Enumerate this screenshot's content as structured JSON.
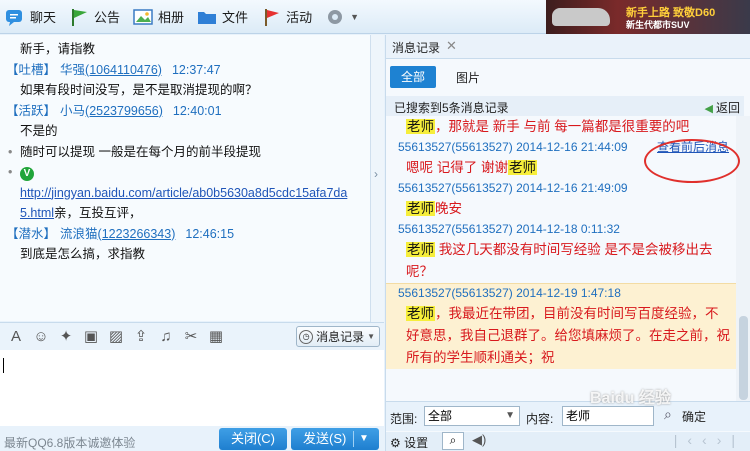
{
  "toolbar": {
    "items": [
      {
        "label": "聊天",
        "icon": "chat-bubble-icon"
      },
      {
        "label": "公告",
        "icon": "flag-icon"
      },
      {
        "label": "相册",
        "icon": "photo-icon"
      },
      {
        "label": "文件",
        "icon": "folder-icon"
      },
      {
        "label": "活动",
        "icon": "red-flag-icon"
      }
    ],
    "gear": "gear-icon"
  },
  "ad": {
    "line1": "新手上路 致敬D60",
    "line2": "新生代都市SUV"
  },
  "chat": {
    "lines": [
      {
        "kind": "msg",
        "text": "新手，请指教"
      },
      {
        "kind": "hdr",
        "tag": "【吐槽】",
        "name": "华强",
        "qq": "(1064110476)",
        "time": "12:37:47"
      },
      {
        "kind": "msg",
        "text": "如果有段时间没写，是不是取消提现的啊？"
      },
      {
        "kind": "hdr",
        "tag": "【活跃】",
        "name": "小马",
        "qq": "(2523799656)",
        "time": "12:40:01"
      },
      {
        "kind": "msg",
        "text": "不是的"
      },
      {
        "kind": "msg",
        "text": "随时可以提现  一般是在每个月的前半段提现"
      },
      {
        "kind": "msg",
        "text": ""
      },
      {
        "kind": "msg",
        "text": "http://jingyan.baidu.com/article/ab0b5630a8d5cdc15afa7da"
      },
      {
        "kind": "msg",
        "text": "5.html亲，互投互评，"
      },
      {
        "kind": "hdr",
        "tag": "【潜水】",
        "name": "流浪猫",
        "qq": "(1223266343)",
        "time": "12:46:15"
      },
      {
        "kind": "msg",
        "text": "到底是怎么搞，求指教"
      }
    ]
  },
  "input_toolbar": {
    "history_label": "消息记录"
  },
  "bottom": {
    "promo": "最新QQ6.8版本诚邀体验",
    "close": "关闭(C)",
    "send": "发送(S)"
  },
  "panel": {
    "tab_title": "消息记录",
    "filter_all": "全部",
    "filter_pic": "图片",
    "found_text": "已搜索到5条消息记录",
    "back": "返回",
    "context_link": "查看前后消息",
    "records": [
      {
        "hdr": "",
        "body_pre": "老师",
        "body": "，那就是 新手 与前  每一篇都是很重要的吧"
      },
      {
        "hdr": "55613527(55613527)  2014-12-16 21:44:09",
        "body_pre": "嗯呢 记得了 谢谢",
        "body": "老师"
      },
      {
        "hdr": "55613527(55613527)  2014-12-16 21:49:09",
        "body_pre": "老师",
        "body": "晚安"
      },
      {
        "hdr": "55613527(55613527)  2014-12-18 0:11:32",
        "body_pre": "老师",
        "body": "  我这几天都没有时间写经验    是不是会被移出去呢？"
      },
      {
        "hdr": "55613527(55613527)  2014-12-19 1:47:18",
        "body_pre": "老师",
        "body": "，我最近在带团，目前没有时间写百度经验，不好意思，我自己退群了。给您填麻烦了。在走之前，祝所有的学生顺利通关；祝"
      }
    ],
    "search_range_label": "范围:",
    "search_range_value": "全部",
    "search_content_label": "内容:",
    "search_content_value": "老师",
    "search_ok": "确定",
    "settings": "设置"
  },
  "watermark": "Baidu 经验"
}
